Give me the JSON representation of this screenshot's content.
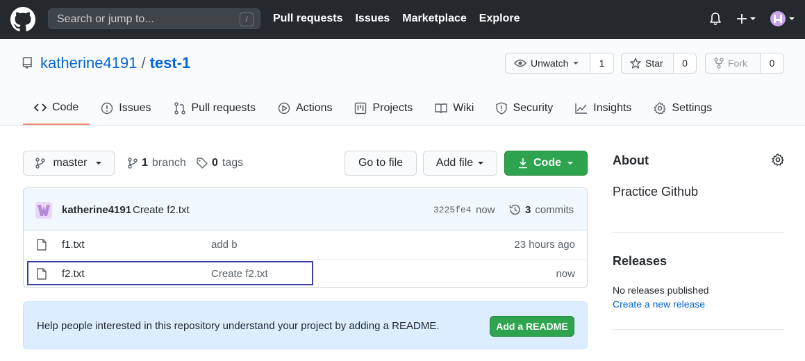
{
  "header": {
    "search_placeholder": "Search or jump to...",
    "search_shortcut": "/",
    "nav": [
      "Pull requests",
      "Issues",
      "Marketplace",
      "Explore"
    ]
  },
  "repo": {
    "owner": "katherine4191",
    "separator": "/",
    "name": "test-1",
    "watch": {
      "label": "Unwatch",
      "count": "1"
    },
    "star": {
      "label": "Star",
      "count": "0"
    },
    "fork": {
      "label": "Fork",
      "count": "0"
    }
  },
  "tabs": [
    {
      "label": "Code",
      "active": true
    },
    {
      "label": "Issues"
    },
    {
      "label": "Pull requests"
    },
    {
      "label": "Actions"
    },
    {
      "label": "Projects"
    },
    {
      "label": "Wiki"
    },
    {
      "label": "Security"
    },
    {
      "label": "Insights"
    },
    {
      "label": "Settings"
    }
  ],
  "toolbar": {
    "branch": "master",
    "branches_count": "1",
    "branches_label": "branch",
    "tags_count": "0",
    "tags_label": "tags",
    "goto_file": "Go to file",
    "add_file": "Add file",
    "code": "Code"
  },
  "latest_commit": {
    "author": "katherine4191",
    "message": "Create f2.txt",
    "sha": "3225fe4",
    "time": "now",
    "commits_count": "3",
    "commits_label": "commits"
  },
  "files": [
    {
      "name": "f1.txt",
      "message": "add b",
      "age": "23 hours ago"
    },
    {
      "name": "f2.txt",
      "message": "Create f2.txt",
      "age": "now"
    }
  ],
  "readme_prompt": {
    "text": "Help people interested in this repository understand your project by adding a README.",
    "button": "Add a README"
  },
  "sidebar": {
    "about_title": "About",
    "description": "Practice Github",
    "releases_title": "Releases",
    "no_releases": "No releases published",
    "create_release": "Create a new release"
  },
  "colors": {
    "header_bg": "#24292e",
    "link": "#0366d6",
    "green": "#2ea44f",
    "active_tab_underline": "#f9826c",
    "highlight_box": "#3b3fa3"
  }
}
